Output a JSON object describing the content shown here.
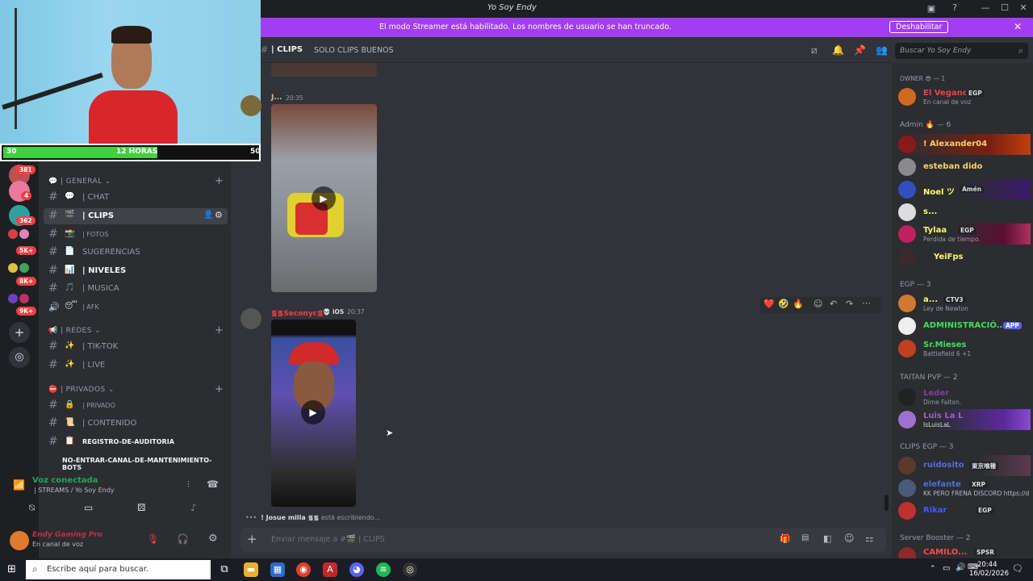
{
  "window": {
    "title": "Yo Soy Endy",
    "minimize": "—",
    "maximize": "☐",
    "close": "✕"
  },
  "banner": {
    "text": "El modo Streamer está habilitado. Los nombres de usuario se han truncado.",
    "button": "Deshabilitar",
    "close": "✕"
  },
  "webcam": {
    "left": "30",
    "center": "12 HORAS",
    "right": "50",
    "progress_fraction": 0.6
  },
  "guild_badges": [
    "381",
    "4",
    "362",
    "5K+",
    "8K+",
    "9K+"
  ],
  "sidebar": {
    "categories": [
      {
        "label": "GENERAL",
        "emoji": "💬"
      },
      {
        "label": "REDES",
        "emoji": "📢"
      },
      {
        "label": "PRIVADOS",
        "emoji": "⛔"
      }
    ],
    "channels": [
      {
        "hash": "#",
        "emoji": "💬",
        "label": "| CHAT",
        "state": "normal"
      },
      {
        "hash": "#",
        "emoji": "🎬",
        "label": "| CLIPS",
        "state": "active"
      },
      {
        "hash": "#",
        "emoji": "📸",
        "label": "| FOTOS",
        "state": "normal"
      },
      {
        "hash": "#",
        "emoji": "📄",
        "label": "SUGERENCIAS",
        "state": "normal"
      },
      {
        "hash": "#",
        "emoji": "📊",
        "label": "| NIVELES",
        "state": "bold"
      },
      {
        "hash": "#",
        "emoji": "🎵",
        "label": "| MUSICA",
        "state": "normal"
      },
      {
        "hash": "🔊",
        "emoji": "😴",
        "label": "| AFK",
        "state": "normal"
      },
      {
        "hash": "#",
        "emoji": "✨",
        "label": "| TIK-TOK",
        "state": "normal"
      },
      {
        "hash": "#",
        "emoji": "✨",
        "label": "| LIVE",
        "state": "normal"
      },
      {
        "hash": "#",
        "emoji": "🔒",
        "label": "| PRIVADO",
        "state": "normal"
      },
      {
        "hash": "#",
        "emoji": "📜",
        "label": "| CONTENIDO",
        "state": "normal"
      },
      {
        "hash": "#",
        "emoji": "📋",
        "label": "REGISTRO-DE-AUDITORIA",
        "state": "bold"
      },
      {
        "hash": "",
        "emoji": "",
        "label": "NO-ENTRAR-CANAL-DE-MANTENIMIENTO-BOTS",
        "state": "bold"
      }
    ]
  },
  "voice": {
    "status": "Voz conectada",
    "channel": "| STREAMS / Yo Soy Endy"
  },
  "user": {
    "name": "Endy Gaming Pro",
    "status": "En canal de voz"
  },
  "header": {
    "channel": "| CLIPS",
    "topic": "SOLO CLIPS BUENOS",
    "search_placeholder": "Buscar Yo Soy Endy"
  },
  "messages": [
    {
      "author": "J...",
      "time": "20:35"
    },
    {
      "author": "᯾᯾Seconyc᯾",
      "platform": "iOS",
      "time": "20:37"
    }
  ],
  "reactions": [
    "❤️",
    "🤣",
    "🔥"
  ],
  "typing": {
    "user": "! Josue milla ᯾᯾",
    "text": "está escribiendo..."
  },
  "composer": {
    "placeholder": "Enviar mensaje a #🎬 | CLIPS"
  },
  "members": {
    "groups": [
      {
        "label": "OWNER 😎 — 1"
      },
      {
        "label": "Admin 🔥 — 6"
      },
      {
        "label": "EGP — 3"
      },
      {
        "label": "TAITAN PVP — 2"
      },
      {
        "label": "CLIPS EGP — 3"
      },
      {
        "label": "Server Booster — 2"
      }
    ],
    "items": [
      {
        "name": "El Vegano",
        "tag": "EGP",
        "status": "En canal de voz",
        "color": "#f23f43"
      },
      {
        "name": "! Alexander04",
        "tag": "",
        "status": "",
        "color": "#ffd166"
      },
      {
        "name": "esteban dido",
        "tag": "",
        "status": "",
        "color": "#ffd166"
      },
      {
        "name": "Noel ツ",
        "tag": "Amén",
        "status": "",
        "color": "#faff6b"
      },
      {
        "name": "s...",
        "tag": "",
        "status": "",
        "color": "#faff6b"
      },
      {
        "name": "Tylaa",
        "tag": "EGP",
        "status": "Perdida de tiempo.",
        "color": "#fff56e"
      },
      {
        "name": "YeiFps",
        "tag": "",
        "status": "",
        "color": "#fff56e"
      },
      {
        "name": "a...",
        "tag": "CTV3",
        "status": "Ley de Newton",
        "color": "#fff56e"
      },
      {
        "name": "ADMINISTRACIÓ...",
        "tag": "APP",
        "status": "",
        "color": "#3ee05a"
      },
      {
        "name": "Sr.Mieses",
        "tag": "",
        "status": "Battlefield 6 +1",
        "color": "#3ee05a"
      },
      {
        "name": "Leder",
        "tag": "",
        "status": "Dime Falton.",
        "color": "#7f3f9f"
      },
      {
        "name": "Luis La L",
        "tag": "",
        "status": "IsLuisLaL",
        "color": "#9f5fbf"
      },
      {
        "name": "ruidosito",
        "tag": "東京喰種",
        "status": "",
        "color": "#4f6fdf"
      },
      {
        "name": "elefante",
        "tag": "XRP",
        "status": "KK PERO FRENA DISCORD https://d",
        "color": "#4f6fdf"
      },
      {
        "name": "Rikar",
        "tag": "EGP",
        "status": "",
        "color": "#3b5bff"
      },
      {
        "name": "CAMILO...",
        "tag": "SPSR",
        "status": "",
        "color": "#ff4a4a"
      }
    ]
  },
  "taskbar": {
    "search_placeholder": "Escribe aquí para buscar.",
    "time": "20:44",
    "date": "16/02/2026"
  },
  "colors": {
    "accent": "#a23ef1",
    "green": "#3fd13f",
    "bg": "#313338"
  }
}
